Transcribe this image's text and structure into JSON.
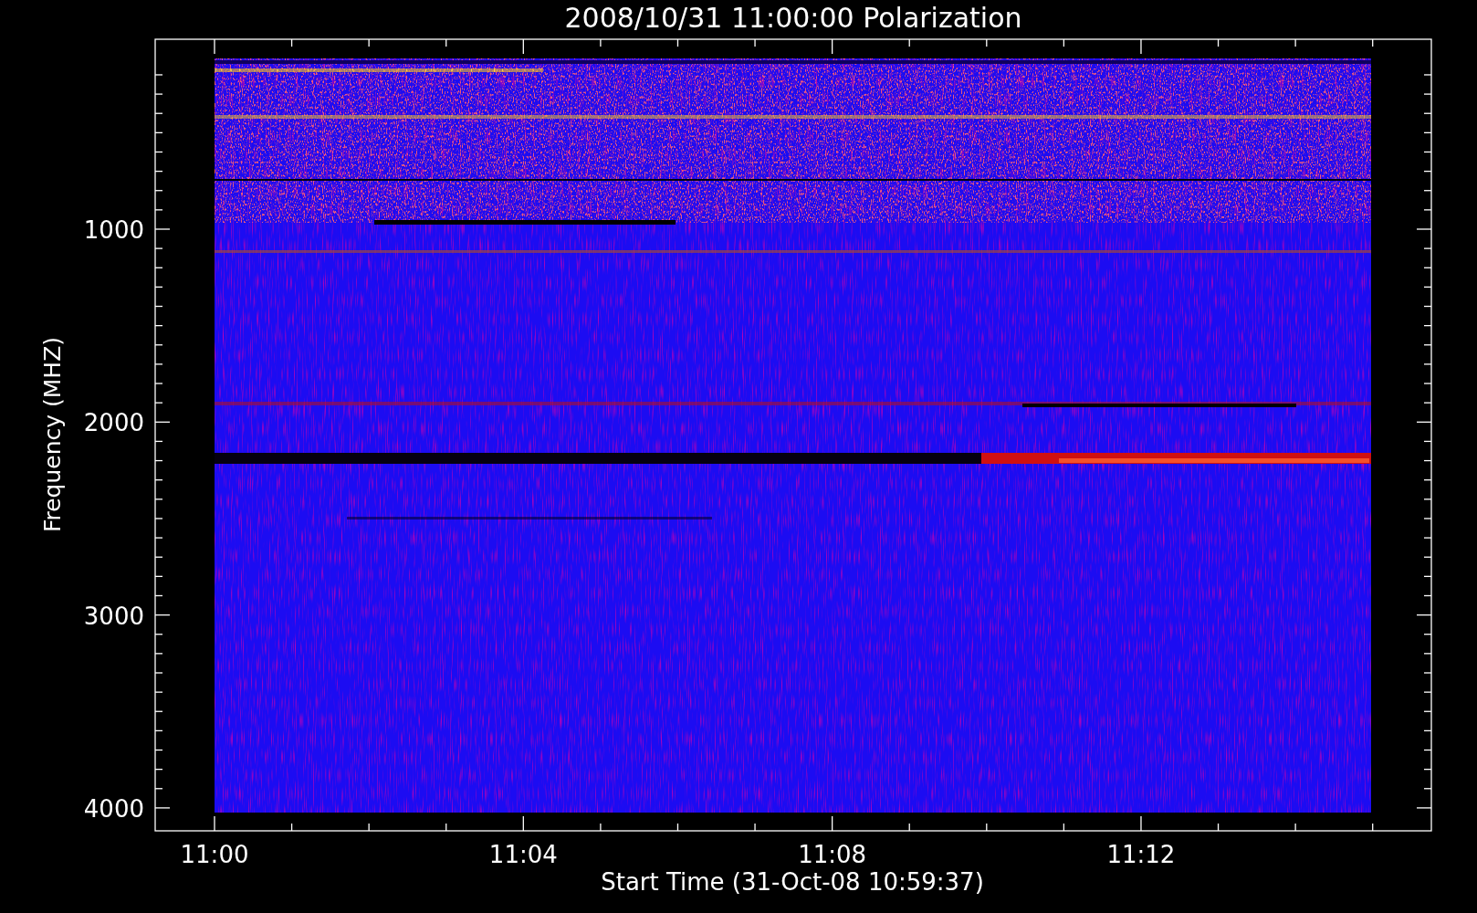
{
  "title": "2008/10/31 11:00:00 Polarization",
  "y_axis": {
    "label": "Frequency (MHZ)",
    "ticks": [
      "1000",
      "2000",
      "3000",
      "4000"
    ]
  },
  "x_axis": {
    "label": "Start Time (31-Oct-08 10:59:37)",
    "ticks": [
      "11:00",
      "11:04",
      "11:08",
      "11:12"
    ]
  }
}
